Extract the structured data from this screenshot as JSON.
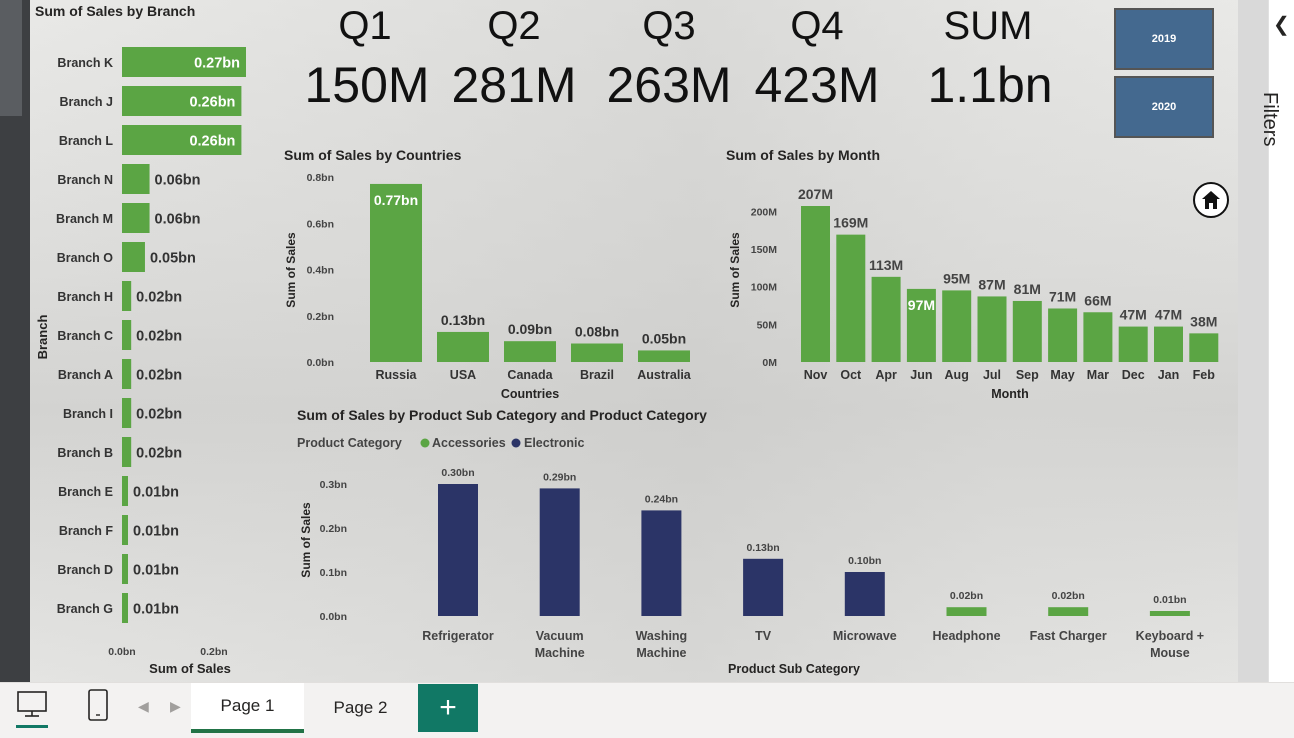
{
  "kpis": [
    {
      "label": "Q1",
      "value": "150M"
    },
    {
      "label": "Q2",
      "value": "281M"
    },
    {
      "label": "Q3",
      "value": "263M"
    },
    {
      "label": "Q4",
      "value": "423M"
    },
    {
      "label": "SUM",
      "value": "1.1bn"
    }
  ],
  "slicer": {
    "year_2019": "2019",
    "year_2020": "2020"
  },
  "filters_label": "Filters",
  "page_tabs": [
    "Page 1",
    "Page 2"
  ],
  "add_tab_label": "+",
  "colors": {
    "green": "#5ba544",
    "navy": "#2b3467",
    "teal": "#117865"
  },
  "icons": [
    "desktop-icon",
    "phone-icon",
    "chevron-left-icon",
    "chevron-right-icon",
    "home-icon",
    "back-arrow-icon",
    "grip-icon"
  ],
  "chart_data": [
    {
      "type": "bar",
      "orientation": "horizontal",
      "title": "Sum of Sales by Branch",
      "xlabel": "Sum of Sales",
      "ylabel": "Branch",
      "xticks": [
        "0.0bn",
        "0.2bn"
      ],
      "categories": [
        "Branch K",
        "Branch J",
        "Branch L",
        "Branch N",
        "Branch M",
        "Branch O",
        "Branch H",
        "Branch C",
        "Branch A",
        "Branch I",
        "Branch B",
        "Branch E",
        "Branch F",
        "Branch D",
        "Branch G"
      ],
      "values": [
        0.27,
        0.26,
        0.26,
        0.06,
        0.06,
        0.05,
        0.02,
        0.02,
        0.02,
        0.02,
        0.02,
        0.01,
        0.01,
        0.01,
        0.01
      ],
      "labels": [
        "0.27bn",
        "0.26bn",
        "0.26bn",
        "0.06bn",
        "0.06bn",
        "0.05bn",
        "0.02bn",
        "0.02bn",
        "0.02bn",
        "0.02bn",
        "0.02bn",
        "0.01bn",
        "0.01bn",
        "0.01bn",
        "0.01bn"
      ],
      "xlim": [
        0,
        0.27
      ]
    },
    {
      "type": "bar",
      "title": "Sum of Sales by Countries",
      "xlabel": "Countries",
      "ylabel": "Sum of Sales",
      "yticks": [
        "0.0bn",
        "0.2bn",
        "0.4bn",
        "0.6bn",
        "0.8bn"
      ],
      "categories": [
        "Russia",
        "USA",
        "Canada",
        "Brazil",
        "Australia"
      ],
      "values": [
        0.77,
        0.13,
        0.09,
        0.08,
        0.05
      ],
      "labels": [
        "0.77bn",
        "0.13bn",
        "0.09bn",
        "0.08bn",
        "0.05bn"
      ],
      "ylim": [
        0,
        0.8
      ]
    },
    {
      "type": "bar",
      "title": "Sum of Sales by Month",
      "xlabel": "Month",
      "ylabel": "Sum of Sales",
      "yticks": [
        "0M",
        "50M",
        "100M",
        "150M",
        "200M"
      ],
      "categories": [
        "Nov",
        "Oct",
        "Apr",
        "Jun",
        "Aug",
        "Jul",
        "Sep",
        "May",
        "Mar",
        "Dec",
        "Jan",
        "Feb"
      ],
      "values": [
        207,
        169,
        113,
        97,
        95,
        87,
        81,
        71,
        66,
        47,
        47,
        38
      ],
      "labels": [
        "207M",
        "169M",
        "113M",
        "97M",
        "95M",
        "87M",
        "81M",
        "71M",
        "66M",
        "47M",
        "47M",
        "38M"
      ],
      "ylim": [
        0,
        207
      ]
    },
    {
      "type": "bar",
      "title": "Sum of Sales by Product Sub Category and Product Category",
      "legend_title": "Product Category",
      "xlabel": "Product Sub Category",
      "ylabel": "Sum of Sales",
      "yticks": [
        "0.0bn",
        "0.1bn",
        "0.2bn",
        "0.3bn"
      ],
      "categories": [
        "Refrigerator",
        "Vacuum Machine",
        "Washing Machine",
        "TV",
        "Microwave",
        "Headphone",
        "Fast Charger",
        "Keyboard + Mouse"
      ],
      "series": [
        {
          "name": "Accessories",
          "color": "#5ba544"
        },
        {
          "name": "Electronic",
          "color": "#2b3467"
        }
      ],
      "values": [
        0.3,
        0.29,
        0.24,
        0.13,
        0.1,
        0.02,
        0.02,
        0.01
      ],
      "category_series": [
        "Electronic",
        "Electronic",
        "Electronic",
        "Electronic",
        "Electronic",
        "Accessories",
        "Accessories",
        "Accessories"
      ],
      "labels": [
        "0.30bn",
        "0.29bn",
        "0.24bn",
        "0.13bn",
        "0.10bn",
        "0.02bn",
        "0.02bn",
        "0.01bn"
      ],
      "ylim": [
        0,
        0.3
      ]
    }
  ]
}
